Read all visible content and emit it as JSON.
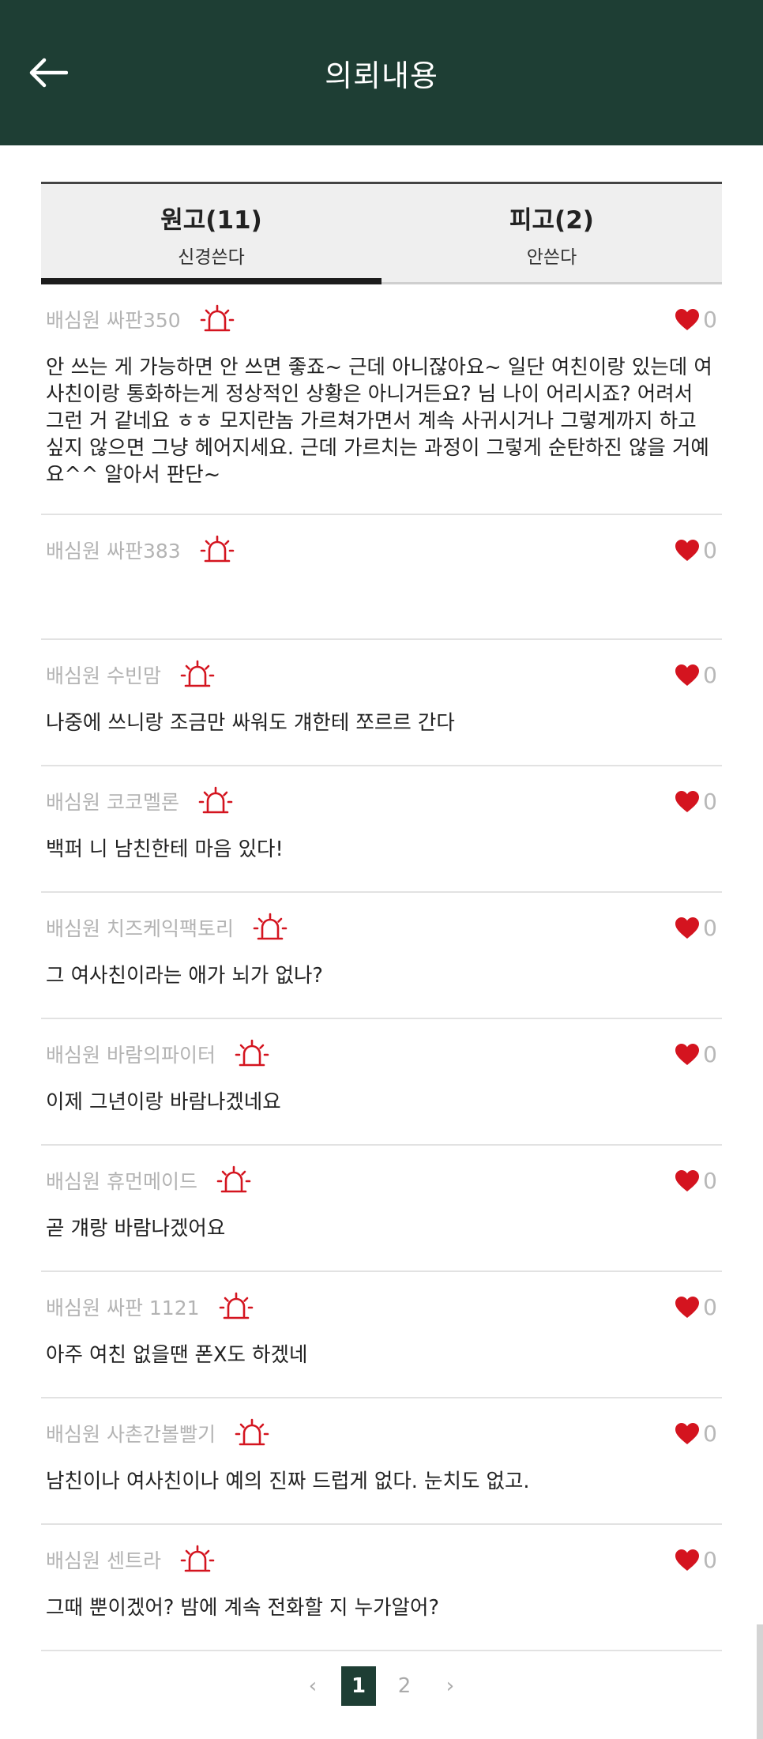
{
  "header": {
    "title": "의뢰내용"
  },
  "tabs": [
    {
      "title": "원고(11)",
      "sub": "신경쓴다"
    },
    {
      "title": "피고(2)",
      "sub": "안쓴다"
    }
  ],
  "comments": [
    {
      "author": "배심원 싸판350",
      "likes": "0",
      "text": "안 쓰는 게 가능하면 안 쓰면 좋죠~ 근데 아니잖아요~ 일단 여친이랑 있는데 여사친이랑 통화하는게 정상적인 상황은 아니거든요? 님 나이 어리시죠? 어려서 그런 거 같네요 ㅎㅎ 모지란놈 가르쳐가면서 계속 사귀시거나 그렇게까지 하고 싶지 않으면 그냥 헤어지세요. 근데 가르치는 과정이 그렇게 순탄하진 않을 거예요^^ 알아서 판단~"
    },
    {
      "author": "배심원 싸판383",
      "likes": "0",
      "text": ""
    },
    {
      "author": "배심원 수빈맘",
      "likes": "0",
      "text": "나중에 쓰니랑 조금만 싸워도 걔한테 쪼르르 간다"
    },
    {
      "author": "배심원 코코멜론",
      "likes": "0",
      "text": "백퍼 니 남친한테 마음 있다!"
    },
    {
      "author": "배심원 치즈케익팩토리",
      "likes": "0",
      "text": "그 여사친이라는 애가 뇌가 없나?"
    },
    {
      "author": "배심원 바람의파이터",
      "likes": "0",
      "text": "이제 그년이랑 바람나겠네요"
    },
    {
      "author": "배심원 휴먼메이드",
      "likes": "0",
      "text": "곧 걔랑 바람나겠어요"
    },
    {
      "author": "배심원 싸판 1121",
      "likes": "0",
      "text": "아주 여친 없을땐 폰X도 하겠네"
    },
    {
      "author": "배심원 사촌간볼빨기",
      "likes": "0",
      "text": "남친이나 여사친이나 예의 진짜 드럽게 없다. 눈치도 없고."
    },
    {
      "author": "배심원 센트라",
      "likes": "0",
      "text": "그때 뿐이겠어? 밤에 계속 전화할 지 누가알어?"
    }
  ],
  "pagination": {
    "prev": "‹",
    "pages": [
      "1",
      "2"
    ],
    "next": "›"
  },
  "colors": {
    "header_bg": "#1e3e34",
    "heart": "#d4141f",
    "siren": "#d4141f"
  }
}
